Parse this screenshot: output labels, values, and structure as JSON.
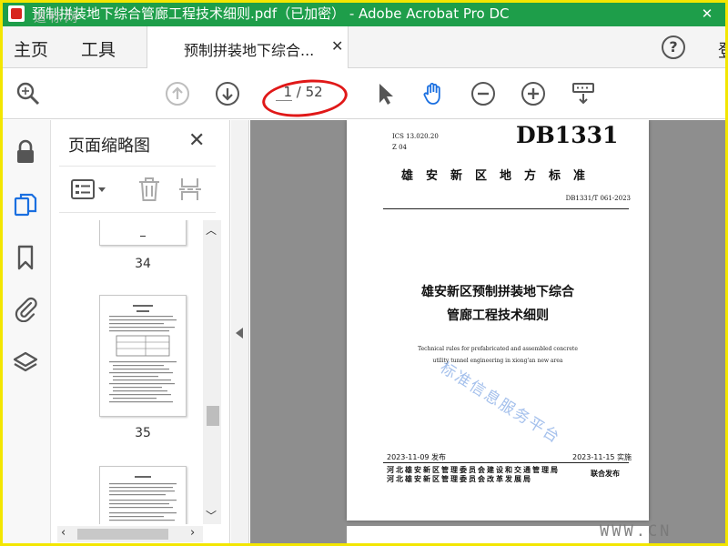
{
  "window": {
    "title": "预制拼装地下综合管廊工程技术细则.pdf（已加密） - Adobe Acrobat Pro DC",
    "close_glyph": "✕",
    "corner_watermark": "道标网"
  },
  "tabs": {
    "home": "主页",
    "tools": "工具",
    "document": "预制拼装地下综合...",
    "help": "?",
    "sign_in": "登"
  },
  "toolbar": {
    "current_page": "1",
    "page_total": "/ 52"
  },
  "panel": {
    "title": "页面缩略图",
    "thumbnails": [
      {
        "label": "34"
      },
      {
        "label": "35"
      },
      {
        "label": ""
      }
    ]
  },
  "document": {
    "ics": "ICS 13.020.20",
    "ccs": "Z 04",
    "standard_code": "DB1331",
    "organization": "雄安新区地方标准",
    "doc_number": "DB1331/T 061-2023",
    "title_line1": "雄安新区预制拼装地下综合",
    "title_line2": "管廊工程技术细则",
    "en_line1": "Technical rules for prefabricated and assembled concrete",
    "en_line2": "utility tunnel engineering in xiong'an new area",
    "issue_date": "2023-11-09 发布",
    "effective_date": "2023-11-15 实施",
    "issuer1": "河北雄安新区管理委员会建设和交通管理局",
    "issuer2": "河北雄安新区管理委员会改革发展局",
    "joint": "联合发布",
    "watermark": "标准信息服务平台",
    "watermark_url": "WWW.CN"
  },
  "colors": {
    "titlebar": "#1e9e4a",
    "border": "#f3e600",
    "accent_blue": "#1a6fe0",
    "annotation_red": "#e01818"
  }
}
